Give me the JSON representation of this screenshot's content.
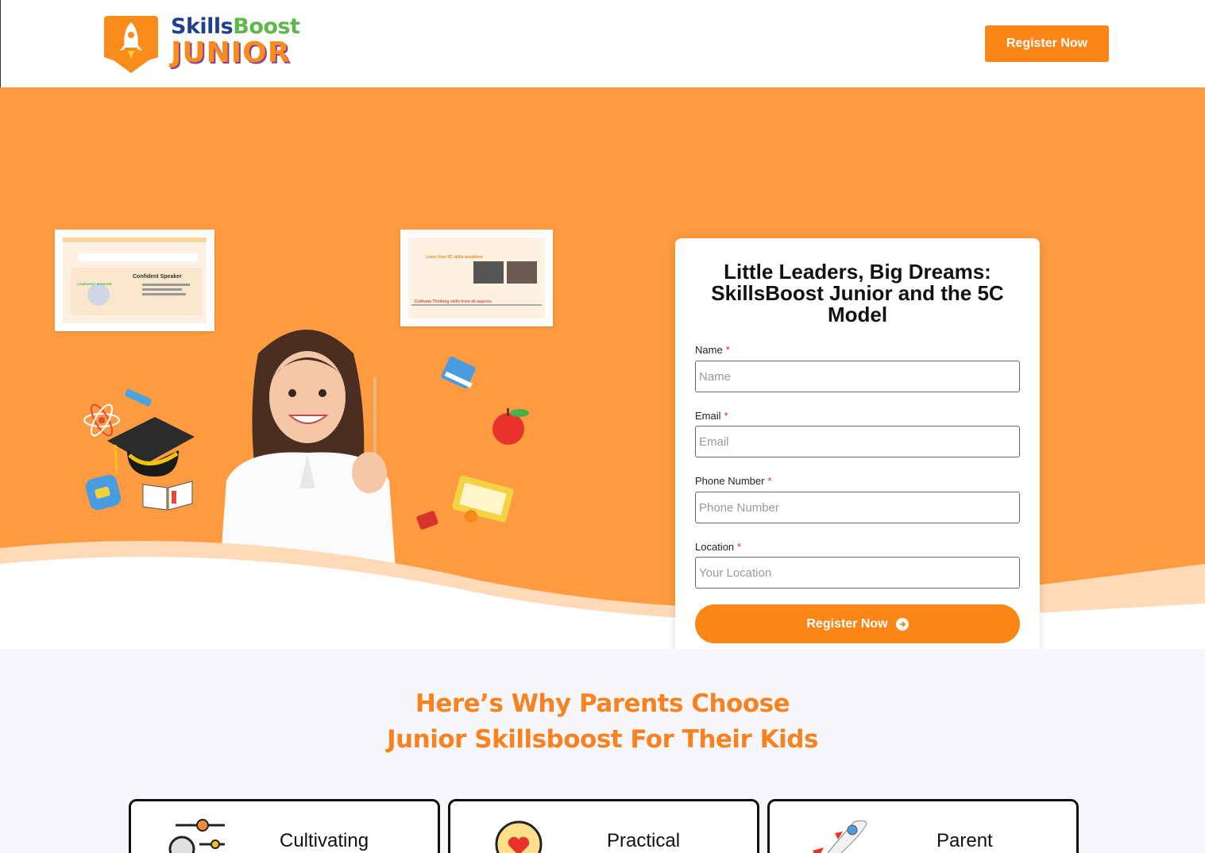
{
  "header": {
    "logo": {
      "line1_a": "Skills",
      "line1_b": "Boost",
      "line2": "JUNIOR"
    },
    "register_label": "Register Now"
  },
  "hero": {
    "thumb1": {
      "title": "Confident Speaker",
      "subtitle": "CONFIDENT SPEAKER"
    },
    "thumb2": {
      "heading": "Learn Your 5C skills anywhere",
      "footer": "Cultivate Thinking skills from all aspects."
    }
  },
  "form": {
    "title": "Little Leaders, Big Dreams: SkillsBoost Junior and the 5C Model",
    "required_mark": "*",
    "fields": [
      {
        "label": "Name",
        "placeholder": "Name"
      },
      {
        "label": "Email",
        "placeholder": "Email"
      },
      {
        "label": "Phone Number",
        "placeholder": "Phone Number"
      },
      {
        "label": "Location",
        "placeholder": "Your Location"
      }
    ],
    "submit_label": "Register Now",
    "submit_icon": "arrow-circle-right-icon"
  },
  "why": {
    "title_line1": "Here’s Why Parents Choose",
    "title_line2": "Junior Skillsboost For Their Kids",
    "cards": [
      {
        "label": "Cultivating",
        "icon": "skills-nodes-icon"
      },
      {
        "label": "Practical",
        "icon": "heart-bulb-icon"
      },
      {
        "label": "Parent",
        "icon": "rocket-icon"
      }
    ]
  },
  "colors": {
    "brand_orange": "#fb8618",
    "hero_bg": "#fe9a40",
    "title_orange": "#f7821f",
    "logo_blue": "#1f3f8f",
    "logo_green": "#5cb84a",
    "section_bg": "#f6f6fb"
  }
}
